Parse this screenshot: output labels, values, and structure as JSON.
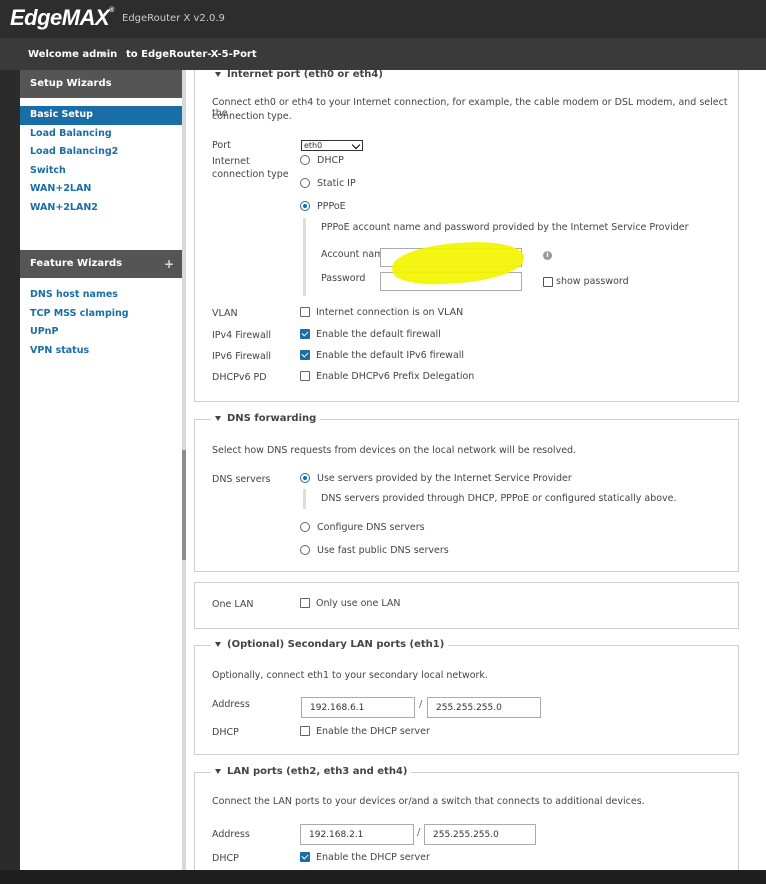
{
  "header": {
    "brand": "EdgeMAX",
    "trademark": "®",
    "version": "EdgeRouter X v2.0.9"
  },
  "welcome": {
    "user": "Welcome admin",
    "router": "to EdgeRouter-X-5-Port"
  },
  "sidebar": {
    "setup_title": "Setup Wizards",
    "setup_items": [
      "Basic Setup",
      "Load Balancing",
      "Load Balancing2",
      "Switch",
      "WAN+2LAN",
      "WAN+2LAN2"
    ],
    "feature_title": "Feature Wizards",
    "feature_plus": "+",
    "feature_items": [
      "DNS host names",
      "TCP MSS clamping",
      "UPnP",
      "VPN status"
    ]
  },
  "internet": {
    "legend": "Internet port (eth0 or eth4)",
    "desc1": "Connect eth0 or eth4 to your Internet connection, for example, the cable modem or DSL modem, and select the",
    "desc2": "connection type.",
    "port_label": "Port",
    "port_value": "eth0",
    "conn_label1": "Internet",
    "conn_label2": "connection type",
    "opt_dhcp": "DHCP",
    "opt_static": "Static IP",
    "opt_pppoe": "PPPoE",
    "pppoe_desc": "PPPoE account name and password provided by the Internet Service Provider",
    "account_label": "Account name",
    "password_label": "Password",
    "show_password": "show password",
    "info": "i",
    "vlan_label": "VLAN",
    "vlan_opt": "Internet connection is on VLAN",
    "ipv4_label": "IPv4 Firewall",
    "ipv4_opt": "Enable the default firewall",
    "ipv6_label": "IPv6 Firewall",
    "ipv6_opt": "Enable the default IPv6 firewall",
    "dhcpv6_label": "DHCPv6 PD",
    "dhcpv6_opt": "Enable DHCPv6 Prefix Delegation"
  },
  "dns": {
    "legend": "DNS forwarding",
    "desc": "Select how DNS requests from devices on the local network will be resolved.",
    "servers_label": "DNS servers",
    "opt_isp": "Use servers provided by the Internet Service Provider",
    "isp_desc": "DNS servers provided through DHCP, PPPoE or configured statically above.",
    "opt_configure": "Configure DNS servers",
    "opt_public": "Use fast public DNS servers"
  },
  "onelan": {
    "label": "One LAN",
    "opt": "Only use one LAN"
  },
  "secondary": {
    "legend": "(Optional) Secondary LAN ports (eth1)",
    "desc": "Optionally, connect eth1 to your secondary local network.",
    "address_label": "Address",
    "address": "192.168.6.1",
    "netmask": "255.255.255.0",
    "slash": "/",
    "dhcp_label": "DHCP",
    "dhcp_opt": "Enable the DHCP server"
  },
  "lan": {
    "legend": "LAN ports (eth2, eth3 and eth4)",
    "desc": "Connect the LAN ports to your devices or/and a switch that connects to additional devices.",
    "address_label": "Address",
    "address": "192.168.2.1",
    "netmask": "255.255.255.0",
    "slash": "/",
    "dhcp_label": "DHCP",
    "dhcp_opt": "Enable the DHCP server"
  }
}
